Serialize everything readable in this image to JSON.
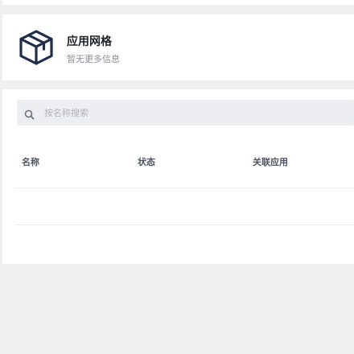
{
  "header": {
    "icon": "box-icon",
    "title": "应用网格",
    "subtitle": "暂无更多信息"
  },
  "search": {
    "icon": "search-icon",
    "placeholder": "按名称搜索",
    "value": ""
  },
  "table": {
    "columns": [
      "名称",
      "状态",
      "关联应用"
    ],
    "rows": []
  },
  "colors": {
    "page_background": "#f0f0f0",
    "card_background": "#ffffff",
    "search_background": "#edeef1",
    "title_text": "#1f2329",
    "muted_text": "#8a8f99",
    "icon_stroke": "#1f2d4d"
  }
}
